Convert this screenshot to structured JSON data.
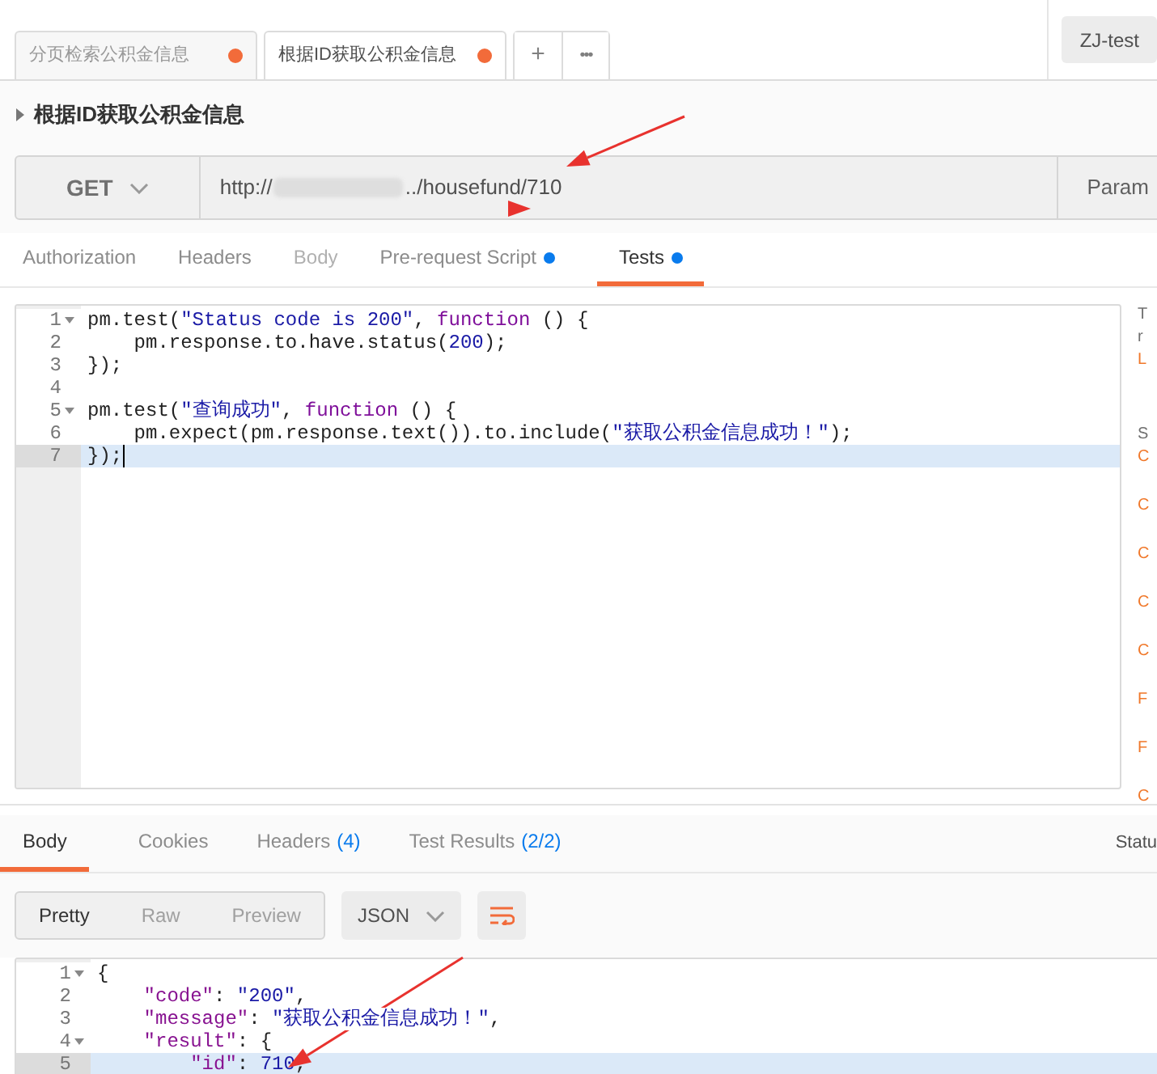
{
  "request_tabs": [
    {
      "label": "分页检索公积金信息",
      "unsaved": true,
      "selected": false
    },
    {
      "label": "根据ID获取公积金信息",
      "unsaved": true,
      "selected": true
    }
  ],
  "new_tab_button": "+",
  "more_button": "•••",
  "environment": "ZJ-test",
  "request_name": "根据ID获取公积金信息",
  "method": "GET",
  "url": {
    "start": "http://",
    "end": "../housefund/710"
  },
  "params_button": "Param",
  "request_subtabs": [
    {
      "label": "Authorization",
      "selected": false,
      "disabled": false,
      "dot": false
    },
    {
      "label": "Headers",
      "selected": false,
      "disabled": false,
      "dot": false
    },
    {
      "label": "Body",
      "selected": false,
      "disabled": true,
      "dot": false
    },
    {
      "label": "Pre-request Script",
      "selected": false,
      "disabled": false,
      "dot": true
    },
    {
      "label": "Tests",
      "selected": true,
      "disabled": false,
      "dot": true
    }
  ],
  "tests_editor": {
    "lines": [
      {
        "number": "1",
        "foldable": true,
        "active": false,
        "tokens": [
          {
            "kind": "plain",
            "text": "pm.test("
          },
          {
            "kind": "string",
            "text": "\"Status code is 200\""
          },
          {
            "kind": "plain",
            "text": ", "
          },
          {
            "kind": "keyword",
            "text": "function"
          },
          {
            "kind": "plain",
            "text": " () {"
          }
        ]
      },
      {
        "number": "2",
        "foldable": false,
        "active": false,
        "tokens": [
          {
            "kind": "plain",
            "text": "    pm.response.to.have.status("
          },
          {
            "kind": "number",
            "text": "200"
          },
          {
            "kind": "plain",
            "text": ");"
          }
        ]
      },
      {
        "number": "3",
        "foldable": false,
        "active": false,
        "tokens": [
          {
            "kind": "plain",
            "text": "});"
          }
        ]
      },
      {
        "number": "4",
        "foldable": false,
        "active": false
      },
      {
        "number": "5",
        "foldable": true,
        "active": false,
        "tokens": [
          {
            "kind": "plain",
            "text": "pm.test("
          },
          {
            "kind": "string",
            "text": "\"查询成功\""
          },
          {
            "kind": "plain",
            "text": ", "
          },
          {
            "kind": "keyword",
            "text": "function"
          },
          {
            "kind": "plain",
            "text": " () {"
          }
        ]
      },
      {
        "number": "6",
        "foldable": false,
        "active": false,
        "tokens": [
          {
            "kind": "plain",
            "text": "    pm.expect(pm.response.text()).to.include("
          },
          {
            "kind": "string",
            "text": "\"获取公积金信息成功！\""
          },
          {
            "kind": "plain",
            "text": ");"
          }
        ]
      },
      {
        "number": "7",
        "foldable": false,
        "active": true,
        "tokens": [
          {
            "kind": "plain",
            "text": "});"
          }
        ]
      }
    ]
  },
  "side_snippets": [
    {
      "kind": "text",
      "text": "T"
    },
    {
      "kind": "text",
      "text": "r"
    },
    {
      "kind": "link",
      "text": "L"
    },
    {
      "kind": "section",
      "text": "S"
    },
    {
      "kind": "link",
      "text": "C"
    },
    {
      "kind": "link",
      "text": "C"
    },
    {
      "kind": "link",
      "text": "C"
    },
    {
      "kind": "link",
      "text": "C"
    },
    {
      "kind": "link",
      "text": "C"
    },
    {
      "kind": "link",
      "text": "F"
    },
    {
      "kind": "link",
      "text": "F"
    },
    {
      "kind": "link",
      "text": "C"
    }
  ],
  "response_tabs": [
    {
      "label": "Body",
      "selected": true
    },
    {
      "label": "Cookies",
      "selected": false
    },
    {
      "label": "Headers",
      "count": "(4)",
      "selected": false
    },
    {
      "label": "Test Results",
      "count": "(2/2)",
      "selected": false
    }
  ],
  "status_label": "Statu",
  "view_modes": [
    {
      "label": "Pretty",
      "selected": true
    },
    {
      "label": "Raw",
      "selected": false
    },
    {
      "label": "Preview",
      "selected": false
    }
  ],
  "format": "JSON",
  "response_body": {
    "lines": [
      {
        "number": "1",
        "foldable": true,
        "active": false,
        "tokens": [
          {
            "kind": "plain",
            "text": "{"
          }
        ]
      },
      {
        "number": "2",
        "foldable": false,
        "active": false,
        "tokens": [
          {
            "kind": "key",
            "text": "    \"code\""
          },
          {
            "kind": "plain",
            "text": ": "
          },
          {
            "kind": "string",
            "text": "\"200\""
          },
          {
            "kind": "plain",
            "text": ","
          }
        ]
      },
      {
        "number": "3",
        "foldable": false,
        "active": false,
        "tokens": [
          {
            "kind": "key",
            "text": "    \"message\""
          },
          {
            "kind": "plain",
            "text": ": "
          },
          {
            "kind": "string",
            "text": "\"获取公积金信息成功！\""
          },
          {
            "kind": "plain",
            "text": ","
          }
        ]
      },
      {
        "number": "4",
        "foldable": true,
        "active": false,
        "tokens": [
          {
            "kind": "key",
            "text": "    \"result\""
          },
          {
            "kind": "plain",
            "text": ": {"
          }
        ]
      },
      {
        "number": "5",
        "foldable": false,
        "active": true,
        "tokens": [
          {
            "kind": "key",
            "text": "        \"id\""
          },
          {
            "kind": "plain",
            "text": ": "
          },
          {
            "kind": "number",
            "text": "710"
          },
          {
            "kind": "plain",
            "text": ","
          }
        ]
      }
    ]
  }
}
